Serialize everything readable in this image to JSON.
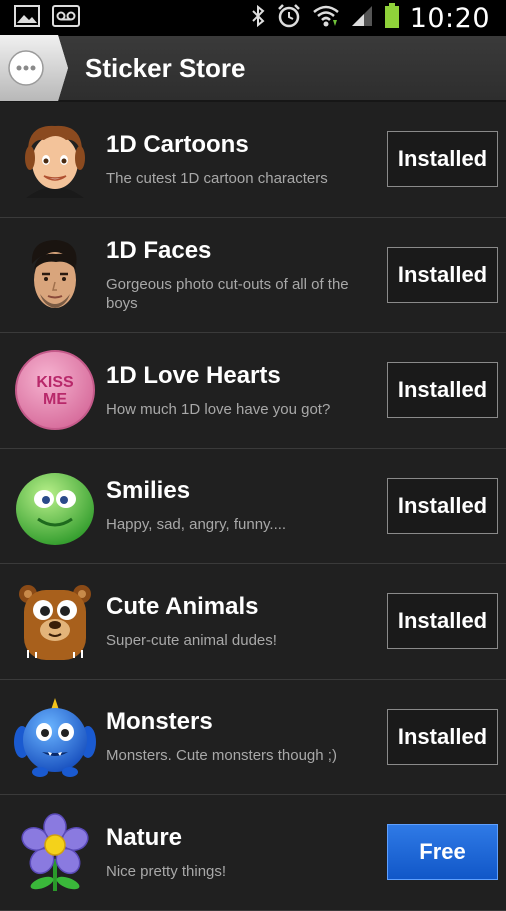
{
  "status_bar": {
    "time": "10:20",
    "icons": [
      "image-icon",
      "voicemail-icon",
      "bluetooth-icon",
      "alarm-icon",
      "wifi-icon",
      "signal-icon",
      "battery-icon"
    ]
  },
  "action_bar": {
    "title": "Sticker Store",
    "app_icon": "chat-bubble-icon"
  },
  "stickers": [
    {
      "name": "1D Cartoons",
      "description": "The cutest 1D cartoon characters",
      "button": "Installed",
      "icon": "cartoon-face-icon"
    },
    {
      "name": "1D Faces",
      "description": "Gorgeous photo cut-outs of all of the boys",
      "button": "Installed",
      "icon": "photo-face-icon"
    },
    {
      "name": "1D Love Hearts",
      "description": "How much 1D love have you got?",
      "button": "Installed",
      "icon": "love-heart-icon",
      "icon_text": "KISS ME"
    },
    {
      "name": "Smilies",
      "description": "Happy, sad, angry, funny....",
      "button": "Installed",
      "icon": "smiley-icon"
    },
    {
      "name": "Cute Animals",
      "description": "Super-cute animal dudes!",
      "button": "Installed",
      "icon": "bear-icon"
    },
    {
      "name": "Monsters",
      "description": "Monsters. Cute monsters though ;)",
      "button": "Installed",
      "icon": "monster-icon"
    },
    {
      "name": "Nature",
      "description": "Nice pretty things!",
      "button": "Free",
      "icon": "flower-icon"
    }
  ],
  "colors": {
    "background": "#202020",
    "free_button": "#1a66d8",
    "installed_button": "#1a1a1a",
    "description_text": "#a8a8a8"
  }
}
